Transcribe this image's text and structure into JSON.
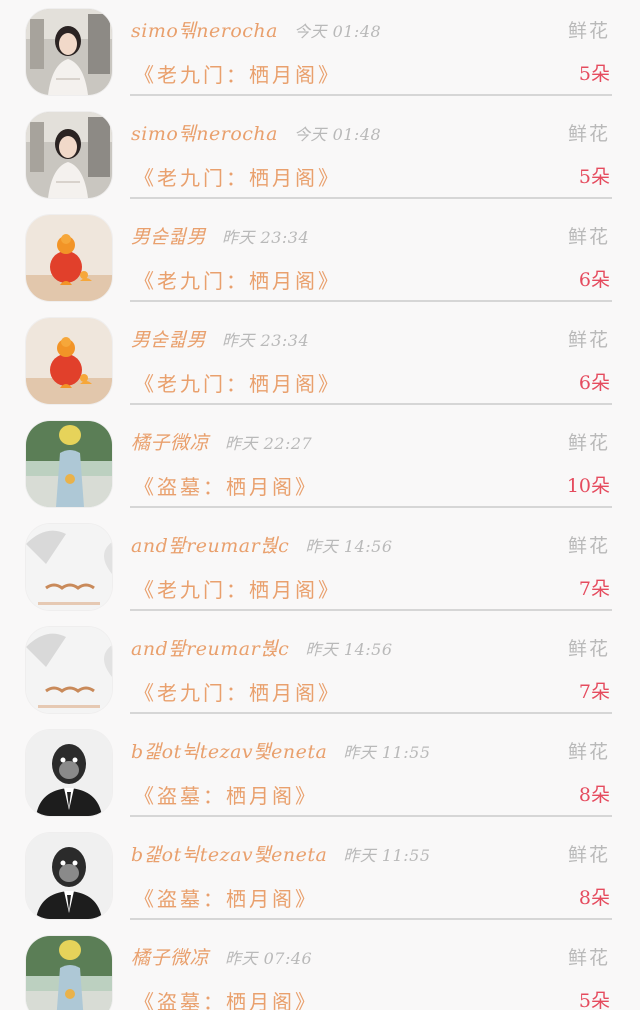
{
  "rows": [
    {
      "name": "simo뒊nerocha",
      "time": "今天 01:48",
      "gift_label": "鲜花",
      "book": "《老九门：栖月阁》",
      "count": "5朵",
      "avatar": "girl-photo"
    },
    {
      "name": "simo뒊nerocha",
      "time": "今天 01:48",
      "gift_label": "鲜花",
      "book": "《老九门：栖月阁》",
      "count": "5朵",
      "avatar": "girl-photo"
    },
    {
      "name": "男숟퀇男",
      "time": "昨天 23:34",
      "gift_label": "鲜花",
      "book": "《老九门：栖月阁》",
      "count": "6朵",
      "avatar": "orange-fruit"
    },
    {
      "name": "男숟퀇男",
      "time": "昨天 23:34",
      "gift_label": "鲜花",
      "book": "《老九门：栖月阁》",
      "count": "6朵",
      "avatar": "orange-fruit"
    },
    {
      "name": "橘子微凉",
      "time": "昨天 22:27",
      "gift_label": "鲜花",
      "book": "《盗墓：栖月阁》",
      "count": "10朵",
      "avatar": "girl-yellow-hat"
    },
    {
      "name": "and뙆reumar붡c",
      "time": "昨天 14:56",
      "gift_label": "鲜花",
      "book": "《老九门：栖月阁》",
      "count": "7朵",
      "avatar": "mustache-sketch"
    },
    {
      "name": "and뙆reumar붡c",
      "time": "昨天 14:56",
      "gift_label": "鲜花",
      "book": "《老九门：栖月阁》",
      "count": "7朵",
      "avatar": "mustache-sketch"
    },
    {
      "name": "b갩ot뉙tezav퇯eneta",
      "time": "昨天 11:55",
      "gift_label": "鲜花",
      "book": "《盗墓：栖月阁》",
      "count": "8朵",
      "avatar": "monkey-suit"
    },
    {
      "name": "b갩ot뉙tezav퇯eneta",
      "time": "昨天 11:55",
      "gift_label": "鲜花",
      "book": "《盗墓：栖月阁》",
      "count": "8朵",
      "avatar": "monkey-suit"
    },
    {
      "name": "橘子微凉",
      "time": "昨天 07:46",
      "gift_label": "鲜花",
      "book": "《盗墓：栖月阁》",
      "count": "5朵",
      "avatar": "girl-yellow-hat"
    }
  ]
}
